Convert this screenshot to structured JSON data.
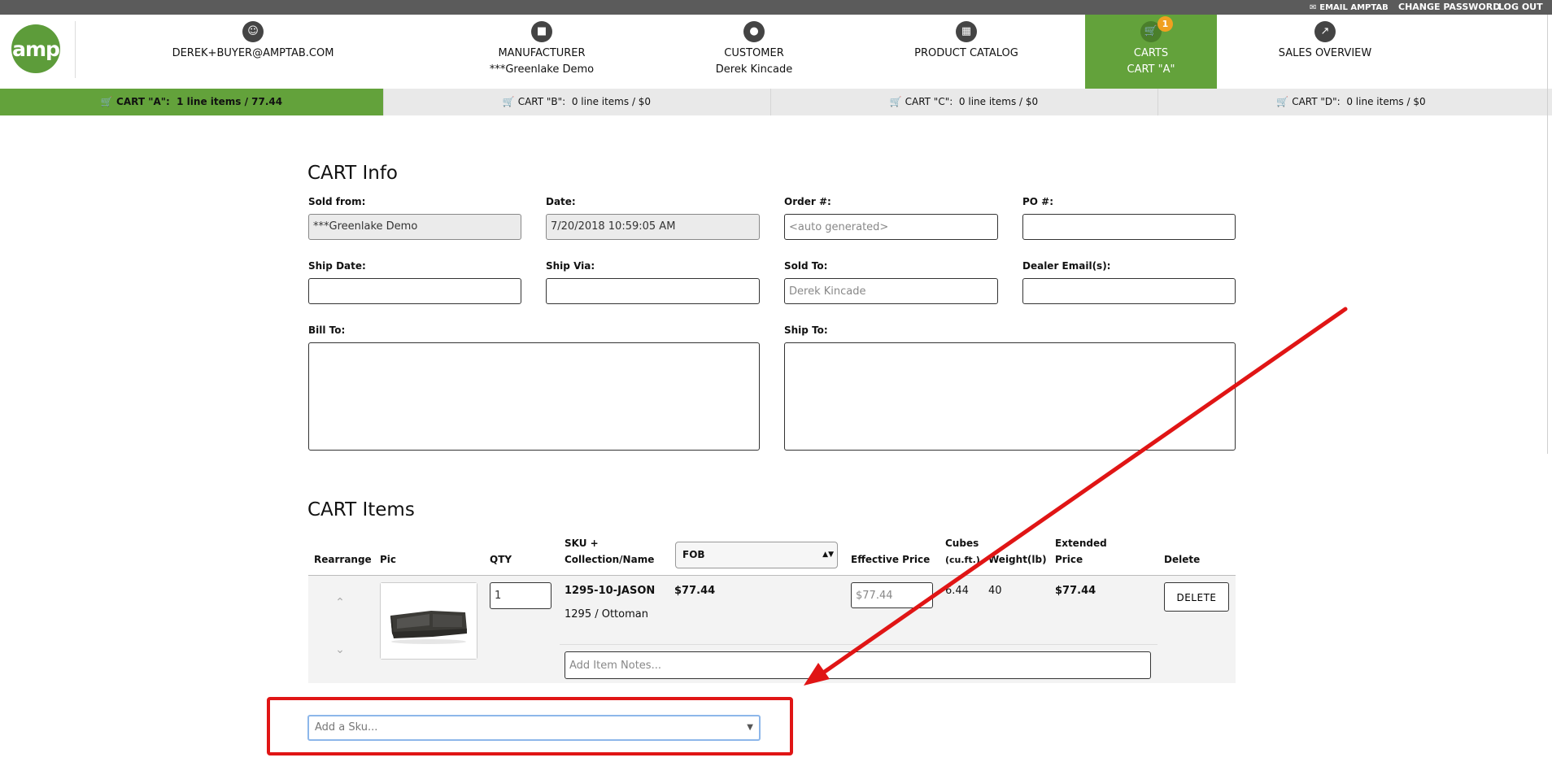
{
  "topbar": {
    "email_amptab": "EMAIL AMPTAB",
    "change_password": "CHANGE PASSWORD",
    "log_out": "LOG OUT"
  },
  "header": {
    "logo_text": "amp",
    "nav": [
      {
        "icon": "user-icon",
        "line1": "DEREK+BUYER@AMPTAB.COM",
        "line2": ""
      },
      {
        "icon": "factory-icon",
        "line1": "MANUFACTURER",
        "line2": "***Greenlake Demo"
      },
      {
        "icon": "users-icon",
        "line1": "CUSTOMER",
        "line2": "Derek Kincade"
      },
      {
        "icon": "grid-icon",
        "line1": "PRODUCT CATALOG",
        "line2": ""
      },
      {
        "icon": "cart-icon",
        "line1": "CARTS",
        "line2": "CART \"A\"",
        "badge": "1"
      },
      {
        "icon": "chart-icon",
        "line1": "SALES OVERVIEW",
        "line2": ""
      }
    ]
  },
  "cart_tabs": [
    {
      "name": "CART \"A\":",
      "summary": "1 line items / 77.44"
    },
    {
      "name": "CART \"B\":",
      "summary": "0 line items / $0"
    },
    {
      "name": "CART \"C\":",
      "summary": "0 line items / $0"
    },
    {
      "name": "CART \"D\":",
      "summary": "0 line items / $0"
    }
  ],
  "cart_info": {
    "title": "CART Info",
    "sold_from_label": "Sold from:",
    "sold_from_value": "***Greenlake Demo",
    "date_label": "Date:",
    "date_value": "7/20/2018 10:59:05 AM",
    "order_label": "Order #:",
    "order_placeholder": "<auto generated>",
    "po_label": "PO #:",
    "ship_date_label": "Ship Date:",
    "ship_via_label": "Ship Via:",
    "sold_to_label": "Sold To:",
    "sold_to_placeholder": "Derek Kincade",
    "dealer_email_label": "Dealer Email(s):",
    "bill_to_label": "Bill To:",
    "ship_to_label": "Ship To:"
  },
  "cart_items": {
    "title": "CART Items",
    "headers": {
      "rearrange": "Rearrange",
      "pic": "Pic",
      "qty": "QTY",
      "sku": "SKU +",
      "sku2": "Collection/Name",
      "price_type": "FOB",
      "effective_price": "Effective Price",
      "cubes": "Cubes",
      "cubes_unit": "(cu.ft.)",
      "weight": "Weight(lb)",
      "extended": "Extended",
      "extended2": "Price",
      "delete": "Delete"
    },
    "rows": [
      {
        "qty": "1",
        "sku": "1295-10-JASON",
        "collection": "1295 / Ottoman",
        "price": "$77.44",
        "effective_price_placeholder": "$77.44",
        "cubes": "6.44",
        "weight": "40",
        "extended_price": "$77.44",
        "delete_label": "DELETE",
        "notes_placeholder": "Add Item Notes..."
      }
    ],
    "add_sku_placeholder": "Add a Sku..."
  },
  "annotation_color": "#e01515",
  "accent_color": "#63a23b"
}
